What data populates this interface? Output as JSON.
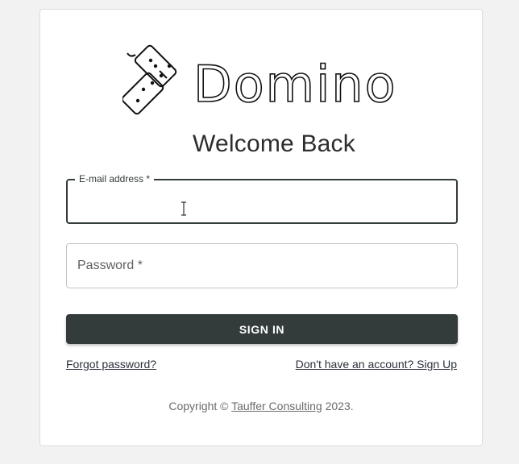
{
  "brand": {
    "name": "Domino"
  },
  "heading": "Welcome Back",
  "form": {
    "email_label": "E-mail address *",
    "email_value": "",
    "password_label": "Password *",
    "password_value": "",
    "submit_label": "SIGN IN"
  },
  "links": {
    "forgot_password": "Forgot password?",
    "sign_up": "Don't have an account? Sign Up"
  },
  "footer": {
    "prefix": "Copyright © ",
    "owner": "Tauffer Consulting",
    "suffix": " 2023."
  },
  "colors": {
    "button_bg": "#333b3b",
    "focused_border": "#343b3b",
    "background": "#f2f2f2"
  }
}
